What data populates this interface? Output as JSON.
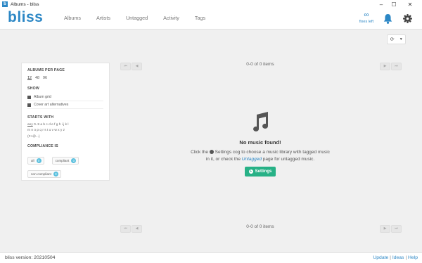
{
  "window": {
    "title": "Albums - bliss",
    "app_icon_letter": "b",
    "controls": [
      "minimize",
      "maximize",
      "close"
    ]
  },
  "header": {
    "logo": "bliss",
    "nav": [
      "Albums",
      "Artists",
      "Untagged",
      "Activity",
      "Tags"
    ],
    "fixes_symbol": "∞",
    "fixes_label": "fixes left",
    "icons": [
      "bell-icon",
      "gear-icon"
    ]
  },
  "toolbar": {
    "refresh_icon": "refresh-icon",
    "caret": "▼"
  },
  "sidebar": {
    "albums_per_page": {
      "title": "ALBUMS PER PAGE",
      "options": [
        "12",
        "48",
        "96"
      ],
      "selected": "12"
    },
    "show": {
      "title": "SHOW",
      "items": [
        "Album grid",
        "Cover art alternatives"
      ]
    },
    "starts_with": {
      "title": "STARTS WITH",
      "all_label": "any",
      "lines": [
        "0..9 a b c d e f g h i j k l",
        "m n o p q r s t u v w x y z",
        "(#+@...)"
      ]
    },
    "compliance": {
      "title": "COMPLIANCE IS",
      "buttons": [
        {
          "label": "all",
          "count": "0"
        },
        {
          "label": "compliant",
          "count": "0"
        },
        {
          "label": "non-compliant",
          "count": "0"
        }
      ]
    }
  },
  "pager": {
    "top_text": "0-0 of 0 items",
    "bottom_text": "0-0 of 0 items",
    "first": "⏮",
    "prev": "◀",
    "next": "▶",
    "last": "⏭"
  },
  "empty_state": {
    "title": "No music found!",
    "line1_pre": "Click the",
    "line1_post": "Settings cog to choose a music library with tagged music in it, or check the",
    "link": "Untagged",
    "line2_post": "page for untagged music.",
    "button": "Settings"
  },
  "footer": {
    "version": "bliss version: 20210504",
    "links": [
      "Update",
      "Ideas",
      "Help"
    ],
    "separator": "|"
  },
  "colors": {
    "brand": "#2c87c5",
    "settings_button": "#27b186",
    "badge": "#5bc0de",
    "background": "#f0f0f0"
  }
}
